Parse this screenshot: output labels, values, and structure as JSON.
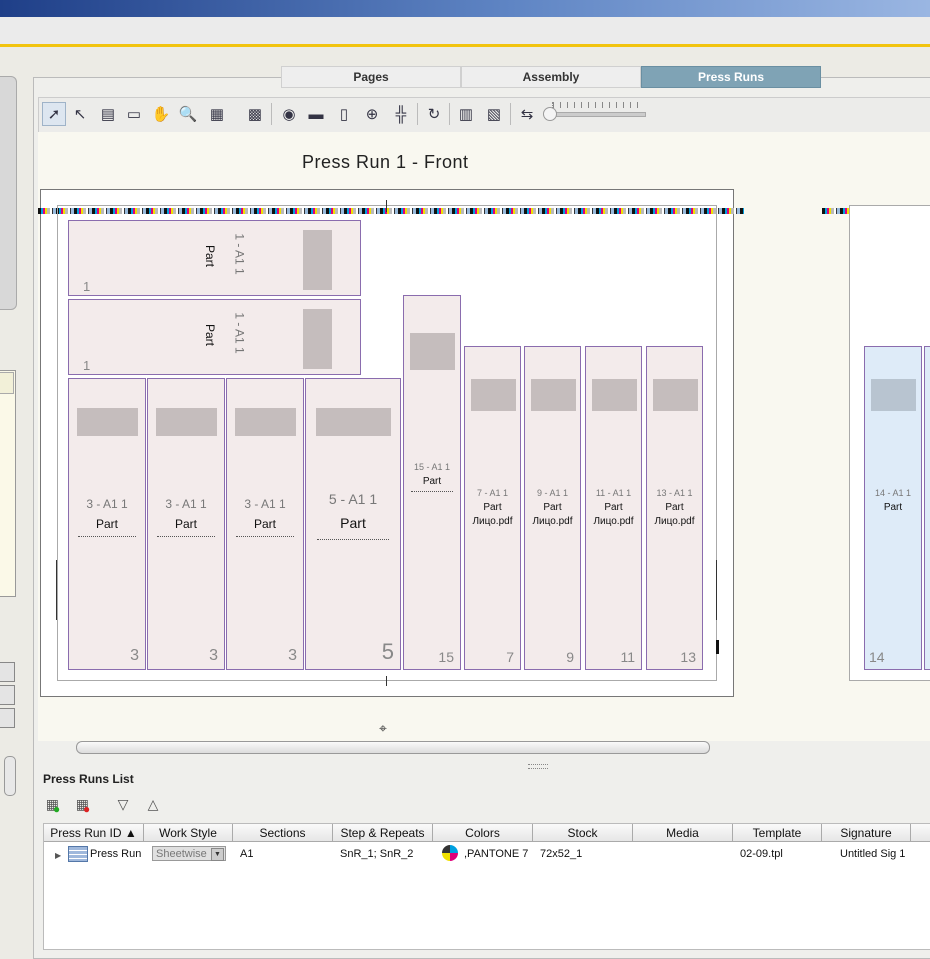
{
  "tabs": [
    {
      "label": "Pages",
      "active": false
    },
    {
      "label": "Assembly",
      "active": false
    },
    {
      "label": "Press Runs",
      "active": true
    }
  ],
  "toolbar": {
    "tools": [
      "select-arrow-icon",
      "select-object-icon",
      "page-numbering-icon",
      "page-icon",
      "hand-icon",
      "zoom-icon",
      "layout-icon",
      "mark-icon",
      "preview-eye-icon",
      "ruler-icon",
      "document-icon",
      "crosshair-icon",
      "split-icon",
      "refresh-icon",
      "step-repeat-icon",
      "arrange-icon",
      "undo-layout-icon"
    ]
  },
  "canvas": {
    "press_run_title": "Press Run 1 - Front",
    "top_pages": [
      {
        "section": "1 - A1 1",
        "part": "Part",
        "number": "1"
      },
      {
        "section": "1 - A1 1",
        "part": "Part",
        "number": "1"
      }
    ],
    "large_pages": [
      {
        "section": "3 - A1 1",
        "part": "Part",
        "number": "3"
      },
      {
        "section": "3 - A1 1",
        "part": "Part",
        "number": "3"
      },
      {
        "section": "3 - A1 1",
        "part": "Part",
        "number": "3"
      },
      {
        "section": "5 - A1 1",
        "part": "Part",
        "number": "5"
      }
    ],
    "tall_page": {
      "section": "15 - A1 1",
      "part": "Part",
      "number": "15"
    },
    "pdf_pages": [
      {
        "section": "7 - A1 1",
        "part": "Part",
        "file": "Лицо.pdf",
        "number": "7"
      },
      {
        "section": "9 - A1 1",
        "part": "Part",
        "file": "Лицо.pdf",
        "number": "9"
      },
      {
        "section": "11 - A1 1",
        "part": "Part",
        "file": "Лицо.pdf",
        "number": "11"
      },
      {
        "section": "13 - A1 1",
        "part": "Part",
        "file": "Лицо.pdf",
        "number": "13"
      }
    ],
    "back_page": {
      "section": "14 - A1 1",
      "part": "Part",
      "number": "14"
    }
  },
  "press_runs_list": {
    "title": "Press Runs List",
    "columns": [
      "Press Run ID ▲",
      "Work Style",
      "Sections",
      "Step & Repeats",
      "Colors",
      "Stock",
      "Media",
      "Template",
      "Signature"
    ],
    "rows": [
      {
        "id": "Press Run",
        "work_style": "Sheetwise",
        "sections": "A1",
        "step_repeats": "SnR_1; SnR_2",
        "colors": ",PANTONE 7",
        "stock": "72x52_1",
        "media": "",
        "template": "02-09.tpl",
        "signature": "Untitled Sig 1"
      }
    ]
  },
  "colors": {
    "accent_tab": "#7fa3b5",
    "page_fill": "#f3ebeb",
    "back_page_fill": "#deebf8",
    "page_border": "#8a6cae"
  }
}
